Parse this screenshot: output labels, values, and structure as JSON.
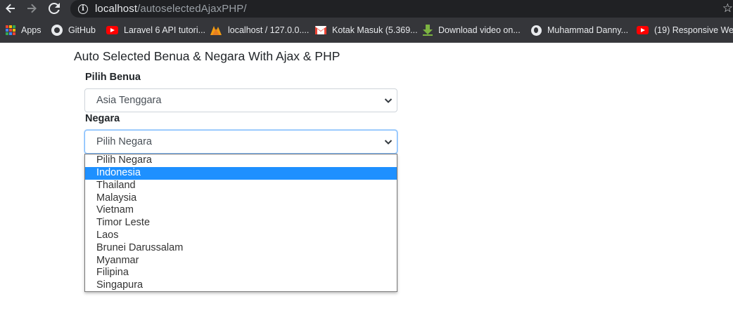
{
  "browser": {
    "url_host": "localhost",
    "url_path": "/autoselectedAjaxPHP/",
    "icons": {
      "back": "back-arrow-icon",
      "forward": "forward-arrow-icon",
      "reload": "reload-icon",
      "info": "info-icon",
      "star": "star-icon"
    }
  },
  "bookmarks": [
    {
      "label": "Apps",
      "icon": "apps-grid-icon"
    },
    {
      "label": "GitHub",
      "icon": "github-icon"
    },
    {
      "label": "Laravel 6 API tutori...",
      "icon": "youtube-icon"
    },
    {
      "label": "localhost / 127.0.0....",
      "icon": "phpmyadmin-icon"
    },
    {
      "label": "Kotak Masuk (5.369...",
      "icon": "gmail-icon"
    },
    {
      "label": "Download video on...",
      "icon": "download-icon"
    },
    {
      "label": "Muhammad Danny...",
      "icon": "globe-icon"
    },
    {
      "label": "(19) Responsive We...",
      "icon": "youtube-icon"
    }
  ],
  "page": {
    "title": "Auto Selected Benua & Negara With Ajax & PHP",
    "benua_label": "Pilih Benua",
    "benua_value": "Asia Tenggara",
    "negara_label": "Negara",
    "negara_value": "Pilih Negara",
    "negara_options": [
      "Pilih Negara",
      "Indonesia",
      "Thailand",
      "Malaysia",
      "Vietnam",
      "Timor Leste",
      "Laos",
      "Brunei Darussalam",
      "Myanmar",
      "Filipina",
      "Singapura"
    ],
    "highlighted_option": "Indonesia"
  },
  "colors": {
    "chrome_bg": "#35363a",
    "omnibox_bg": "#202124",
    "highlight": "#1e90ff",
    "focus_border": "#80bdff",
    "youtube_red": "#ff0000"
  }
}
